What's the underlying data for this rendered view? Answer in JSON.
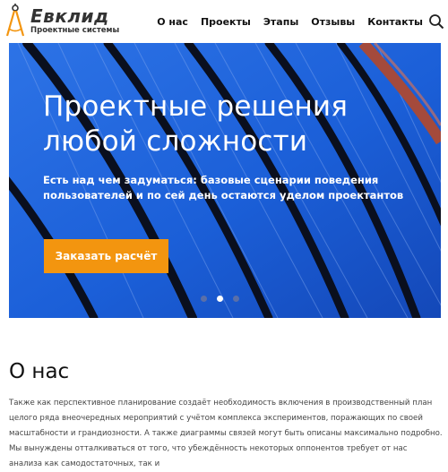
{
  "header": {
    "logo_name": "Евклид",
    "logo_tagline": "Проектные системы",
    "nav": [
      {
        "label": "О нас"
      },
      {
        "label": "Проекты"
      },
      {
        "label": "Этапы"
      },
      {
        "label": "Отзывы"
      },
      {
        "label": "Контакты"
      }
    ],
    "search_icon": "search-icon",
    "logo_icon": "compass-icon"
  },
  "hero": {
    "title_line1": "Проектные решения",
    "title_line2": "любой сложности",
    "subtitle": "Есть над чем задуматься: базовые сценарии поведения пользователей и по сей день остаются уделом проектантов",
    "cta_label": "Заказать расчёт",
    "slides_total": 3,
    "active_slide": 2
  },
  "about": {
    "title": "О нас",
    "text": "Также как перспективное планирование создаёт необходимость включения в производственный план целого ряда внеочередных мероприятий с учётом комплекса экспериментов, поражающих по своей масштабности и грандиозности. А также диаграммы связей могут быть описаны максимально подробно. Мы вынуждены отталкиваться от того, что убеждённость некоторых оппонентов требует от нас анализа как самодостаточных, так и"
  },
  "colors": {
    "accent": "#f3950f",
    "hero_blue": "#1d5fd6",
    "logo_orange": "#f3950f"
  }
}
